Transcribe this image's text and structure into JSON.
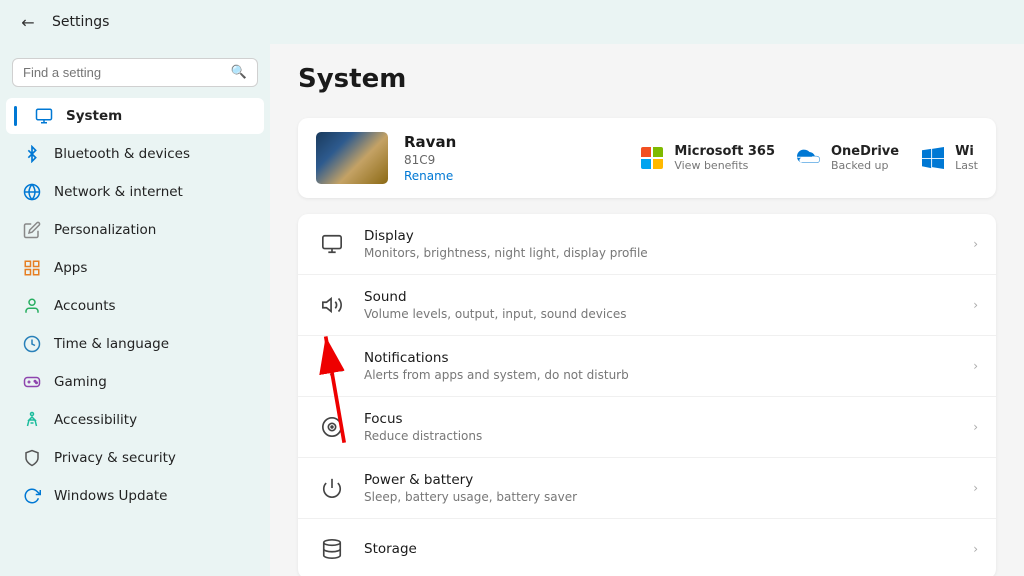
{
  "titleBar": {
    "title": "Settings"
  },
  "sidebar": {
    "searchPlaceholder": "Find a setting",
    "items": [
      {
        "id": "system",
        "label": "System",
        "icon": "💻",
        "iconClass": "icon-system",
        "active": true
      },
      {
        "id": "bluetooth",
        "label": "Bluetooth & devices",
        "icon": "🔵",
        "iconClass": "icon-bluetooth",
        "active": false
      },
      {
        "id": "network",
        "label": "Network & internet",
        "icon": "🌐",
        "iconClass": "icon-network",
        "active": false
      },
      {
        "id": "personalization",
        "label": "Personalization",
        "icon": "✏️",
        "iconClass": "icon-personalization",
        "active": false
      },
      {
        "id": "apps",
        "label": "Apps",
        "icon": "📦",
        "iconClass": "icon-apps",
        "active": false
      },
      {
        "id": "accounts",
        "label": "Accounts",
        "icon": "👤",
        "iconClass": "icon-accounts",
        "active": false
      },
      {
        "id": "time",
        "label": "Time & language",
        "icon": "🌍",
        "iconClass": "icon-time",
        "active": false
      },
      {
        "id": "gaming",
        "label": "Gaming",
        "icon": "🎮",
        "iconClass": "icon-gaming",
        "active": false
      },
      {
        "id": "accessibility",
        "label": "Accessibility",
        "icon": "♿",
        "iconClass": "icon-accessibility",
        "active": false
      },
      {
        "id": "privacy",
        "label": "Privacy & security",
        "icon": "🛡️",
        "iconClass": "icon-privacy",
        "active": false
      },
      {
        "id": "update",
        "label": "Windows Update",
        "icon": "🔄",
        "iconClass": "icon-update",
        "active": false
      }
    ]
  },
  "content": {
    "pageTitle": "System",
    "device": {
      "name": "Ravan",
      "id": "81C9",
      "renameLabel": "Rename"
    },
    "services": [
      {
        "id": "ms365",
        "title": "Microsoft 365",
        "subtitle": "View benefits"
      },
      {
        "id": "onedrive",
        "title": "OneDrive",
        "subtitle": "Backed up"
      },
      {
        "id": "windows",
        "title": "Wi",
        "subtitle": "Last"
      }
    ],
    "settingsItems": [
      {
        "id": "display",
        "icon": "🖥",
        "title": "Display",
        "desc": "Monitors, brightness, night light, display profile"
      },
      {
        "id": "sound",
        "icon": "🔊",
        "title": "Sound",
        "desc": "Volume levels, output, input, sound devices"
      },
      {
        "id": "notifications",
        "icon": "🔔",
        "title": "Notifications",
        "desc": "Alerts from apps and system, do not disturb"
      },
      {
        "id": "focus",
        "icon": "🎯",
        "title": "Focus",
        "desc": "Reduce distractions"
      },
      {
        "id": "power",
        "icon": "⏻",
        "title": "Power & battery",
        "desc": "Sleep, battery usage, battery saver"
      },
      {
        "id": "storage",
        "icon": "💾",
        "title": "Storage",
        "desc": ""
      }
    ]
  }
}
